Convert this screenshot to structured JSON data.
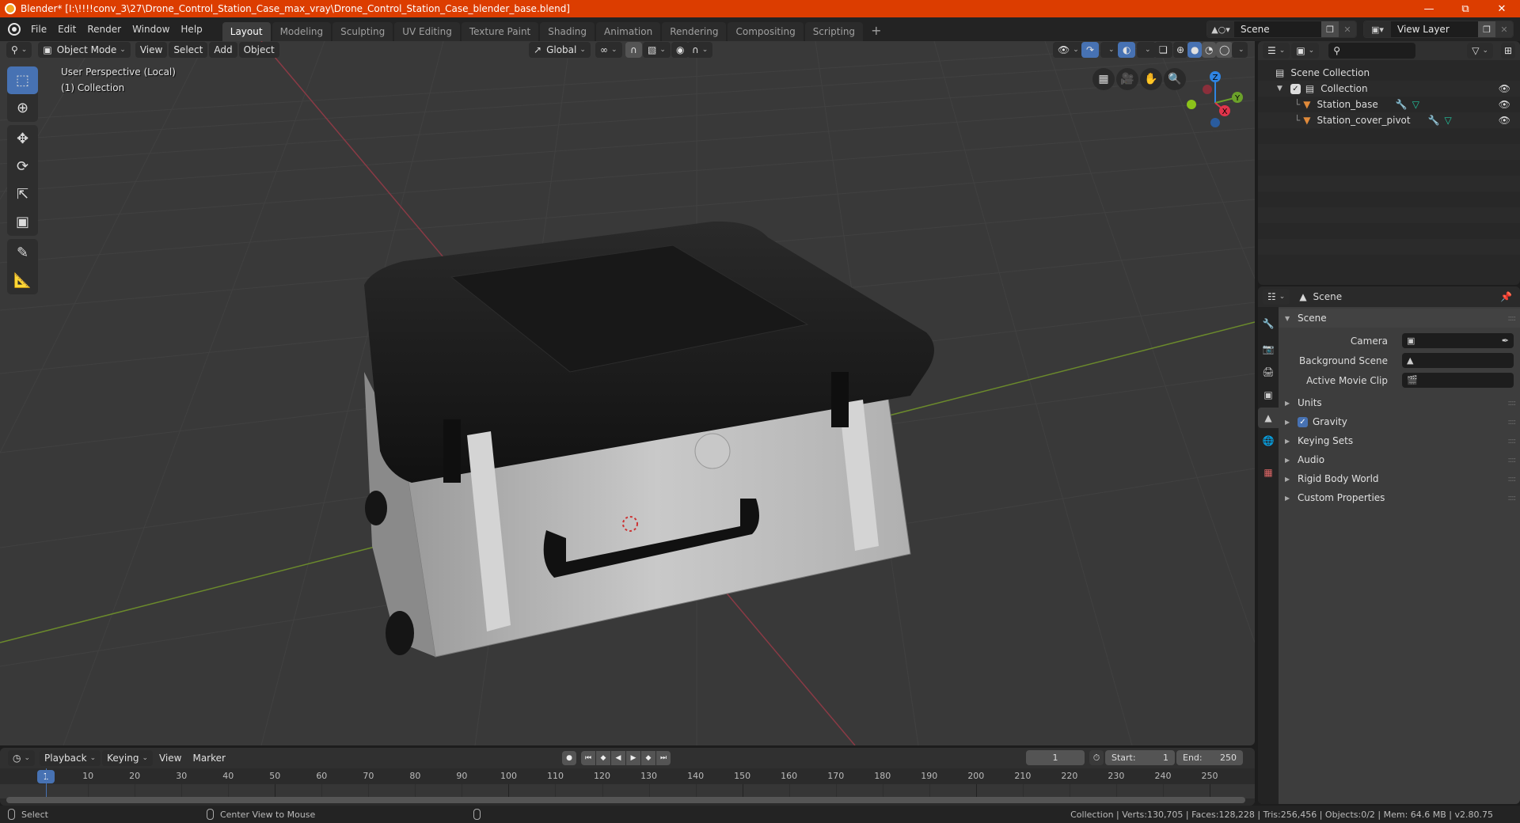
{
  "window": {
    "title": "Blender* [I:\\!!!!conv_3\\27\\Drone_Control_Station_Case_max_vray\\Drone_Control_Station_Case_blender_base.blend]",
    "controls": [
      "minimize",
      "restore",
      "close"
    ]
  },
  "menubar": {
    "items": [
      "File",
      "Edit",
      "Render",
      "Window",
      "Help"
    ],
    "workspaces": [
      "Layout",
      "Modeling",
      "Sculpting",
      "UV Editing",
      "Texture Paint",
      "Shading",
      "Animation",
      "Rendering",
      "Compositing",
      "Scripting"
    ],
    "active_workspace": "Layout",
    "add_workspace": "+",
    "scene": "Scene",
    "view_layer": "View Layer"
  },
  "viewport": {
    "mode": "Object Mode",
    "menus": [
      "View",
      "Select",
      "Add",
      "Object"
    ],
    "orientation": "Global",
    "info_line1": "User Perspective (Local)",
    "info_line2": "(1) Collection",
    "gizmo_axes": [
      "X",
      "Y",
      "Z"
    ],
    "shading_active": "solid",
    "accent": "#4772b3"
  },
  "outliner": {
    "root": "Scene Collection",
    "collection": "Collection",
    "objects": [
      {
        "name": "Station_base"
      },
      {
        "name": "Station_cover_pivot"
      }
    ]
  },
  "properties": {
    "context": "Scene",
    "panel_title": "Scene",
    "fields": [
      {
        "label": "Camera",
        "value": ""
      },
      {
        "label": "Background Scene",
        "value": ""
      },
      {
        "label": "Active Movie Clip",
        "value": ""
      }
    ],
    "subpanels": [
      {
        "label": "Units",
        "checkbox": false
      },
      {
        "label": "Gravity",
        "checkbox": true,
        "checked": true
      },
      {
        "label": "Keying Sets",
        "checkbox": false
      },
      {
        "label": "Audio",
        "checkbox": false
      },
      {
        "label": "Rigid Body World",
        "checkbox": false
      },
      {
        "label": "Custom Properties",
        "checkbox": false
      }
    ]
  },
  "timeline": {
    "menus": [
      "Playback",
      "Keying",
      "View",
      "Marker"
    ],
    "current_frame": "1",
    "start_label": "Start:",
    "start": "1",
    "end_label": "End:",
    "end": "250",
    "ticks": [
      "10",
      "20",
      "30",
      "40",
      "50",
      "60",
      "70",
      "80",
      "90",
      "100",
      "110",
      "120",
      "130",
      "140",
      "150",
      "160",
      "170",
      "180",
      "190",
      "200",
      "210",
      "220",
      "230",
      "240",
      "250"
    ]
  },
  "statusbar": {
    "left_action": "Select",
    "middle_action": "Center View to Mouse",
    "stats": "Collection | Verts:130,705 | Faces:128,228 | Tris:256,456 | Objects:0/2 | Mem: 64.6 MB | v2.80.75"
  }
}
